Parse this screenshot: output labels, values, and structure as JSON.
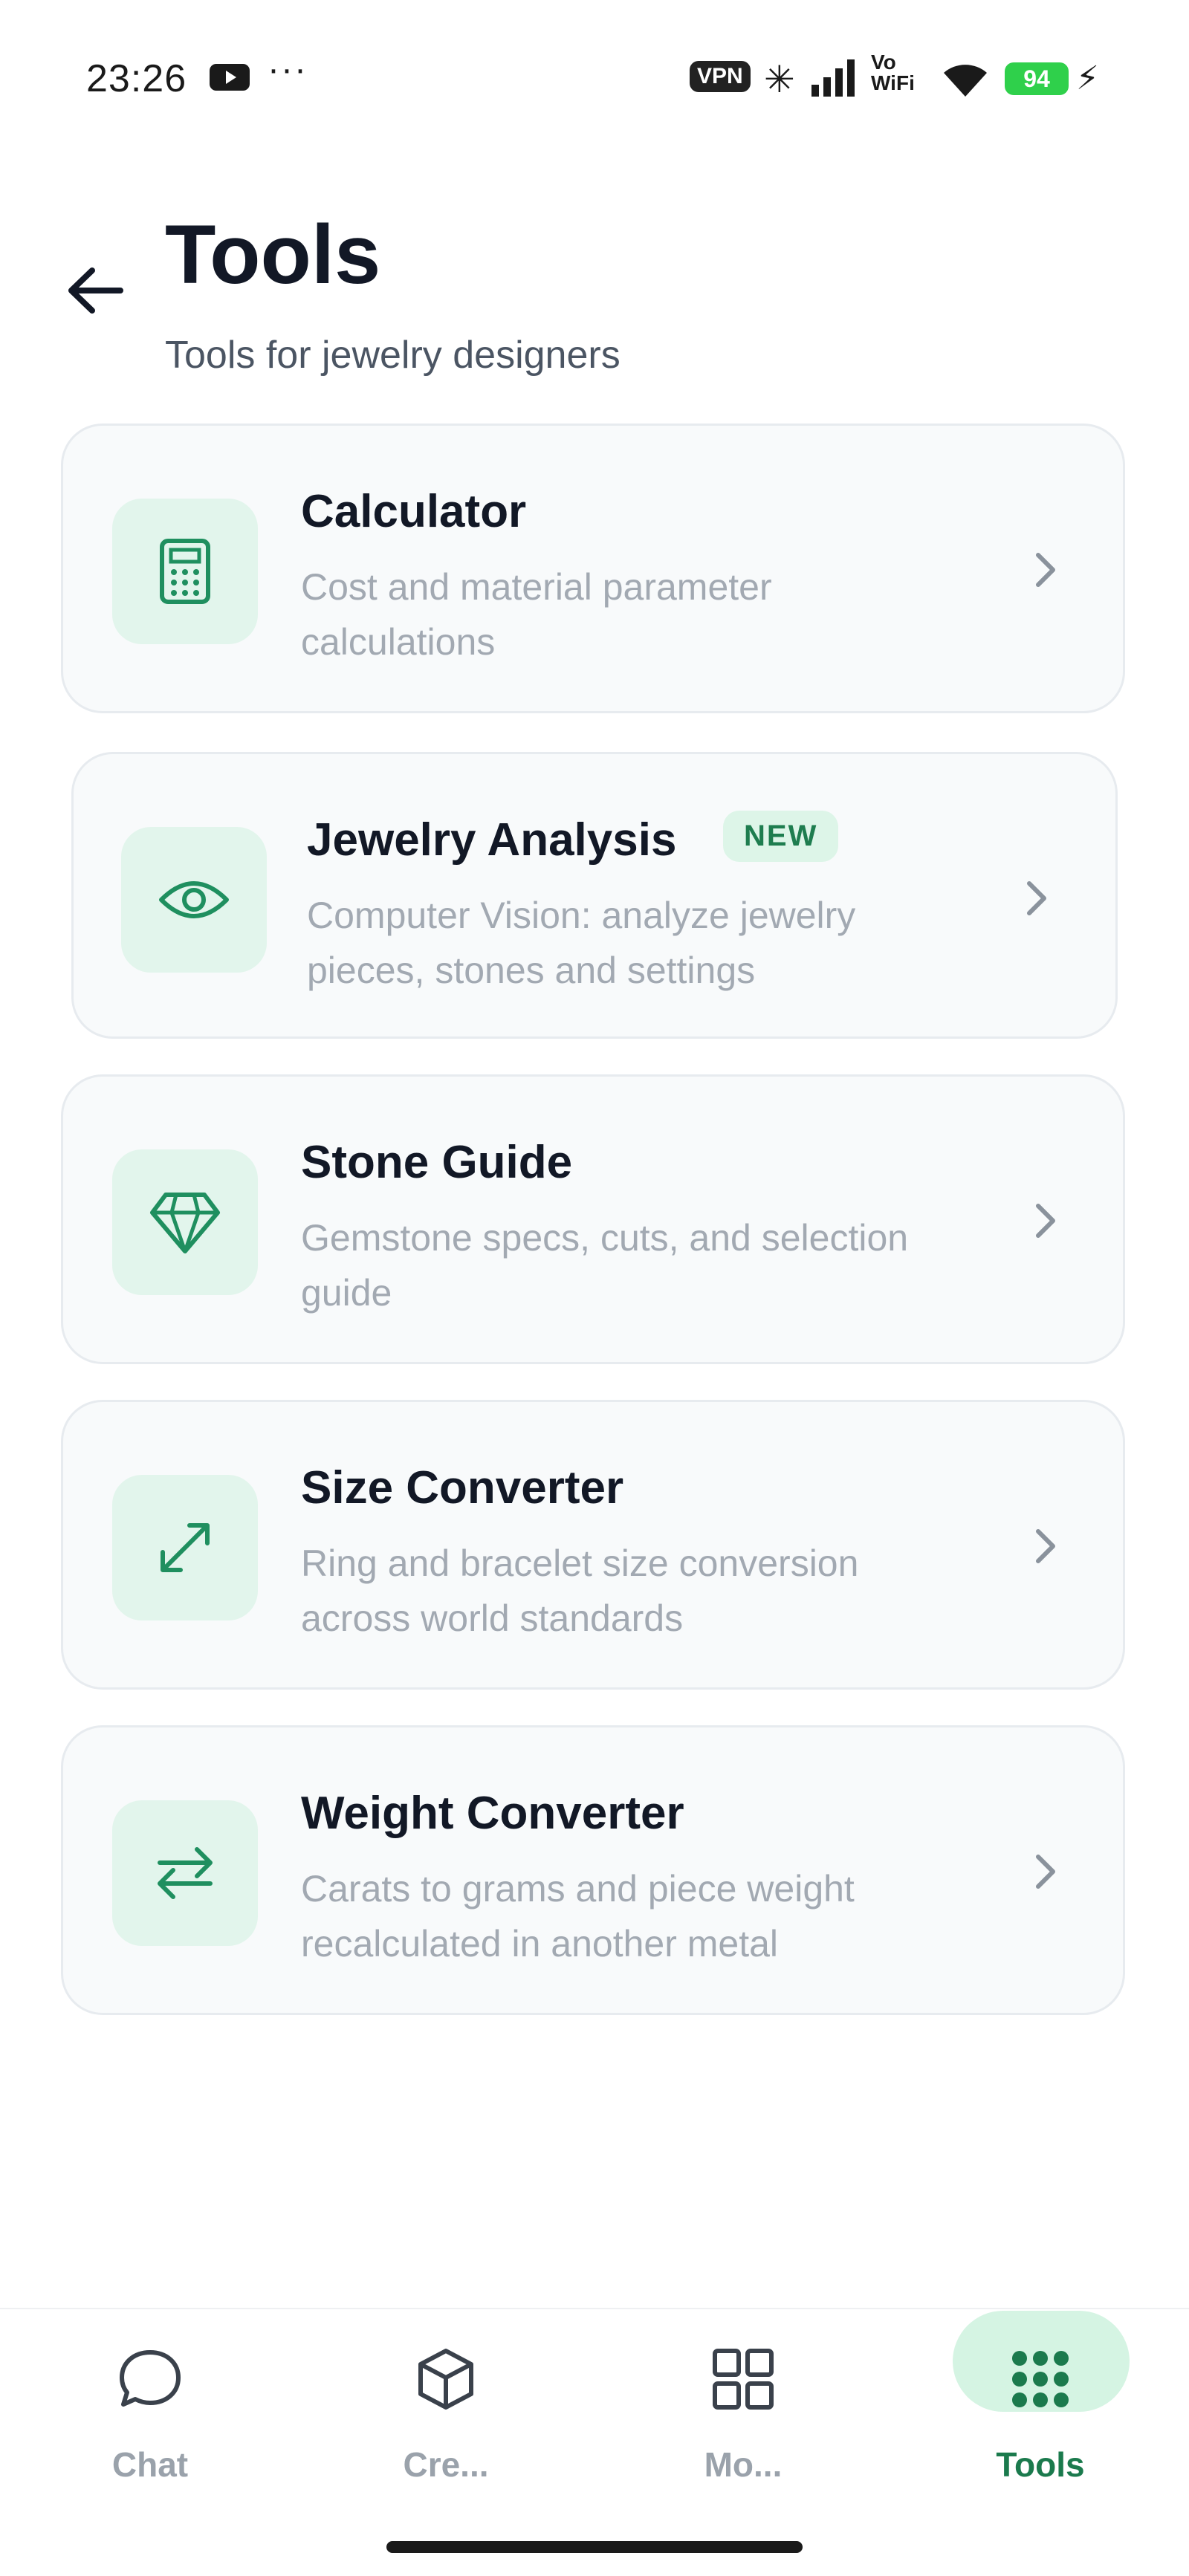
{
  "status_bar": {
    "time": "23:26",
    "vpn_label": "VPN",
    "volte_label": "Vo\nWiFi",
    "battery_level": "94"
  },
  "header": {
    "title": "Tools",
    "subtitle": "Tools for jewelry designers"
  },
  "tools": [
    {
      "title": "Calculator",
      "description": "Cost and material parameter calculations",
      "icon": "calculator-icon"
    },
    {
      "title": "Jewelry Analysis",
      "badge": "NEW",
      "description": "Computer Vision: analyze jewelry pieces, stones and settings",
      "icon": "eye-icon"
    },
    {
      "title": "Stone Guide",
      "description": "Gemstone specs, cuts, and selection guide",
      "icon": "diamond-icon"
    },
    {
      "title": "Size Converter",
      "description": "Ring and bracelet size conversion across world standards",
      "icon": "resize-arrows-icon"
    },
    {
      "title": "Weight Converter",
      "description": "Carats to grams and piece weight recalculated in another metal",
      "icon": "swap-arrows-icon"
    }
  ],
  "bottom_nav": {
    "items": [
      {
        "label": "Chat",
        "icon": "chat-bubble-icon"
      },
      {
        "label": "Cre...",
        "icon": "cube-icon"
      },
      {
        "label": "Mo...",
        "icon": "grid-icon"
      },
      {
        "label": "Tools",
        "icon": "dots-grid-icon",
        "active": true
      }
    ]
  },
  "colors": {
    "accent": "#1f8f5f",
    "icon_bg": "#e2f5ec",
    "card_bg": "#f8fafb",
    "active_pill": "#d5f4e3"
  }
}
